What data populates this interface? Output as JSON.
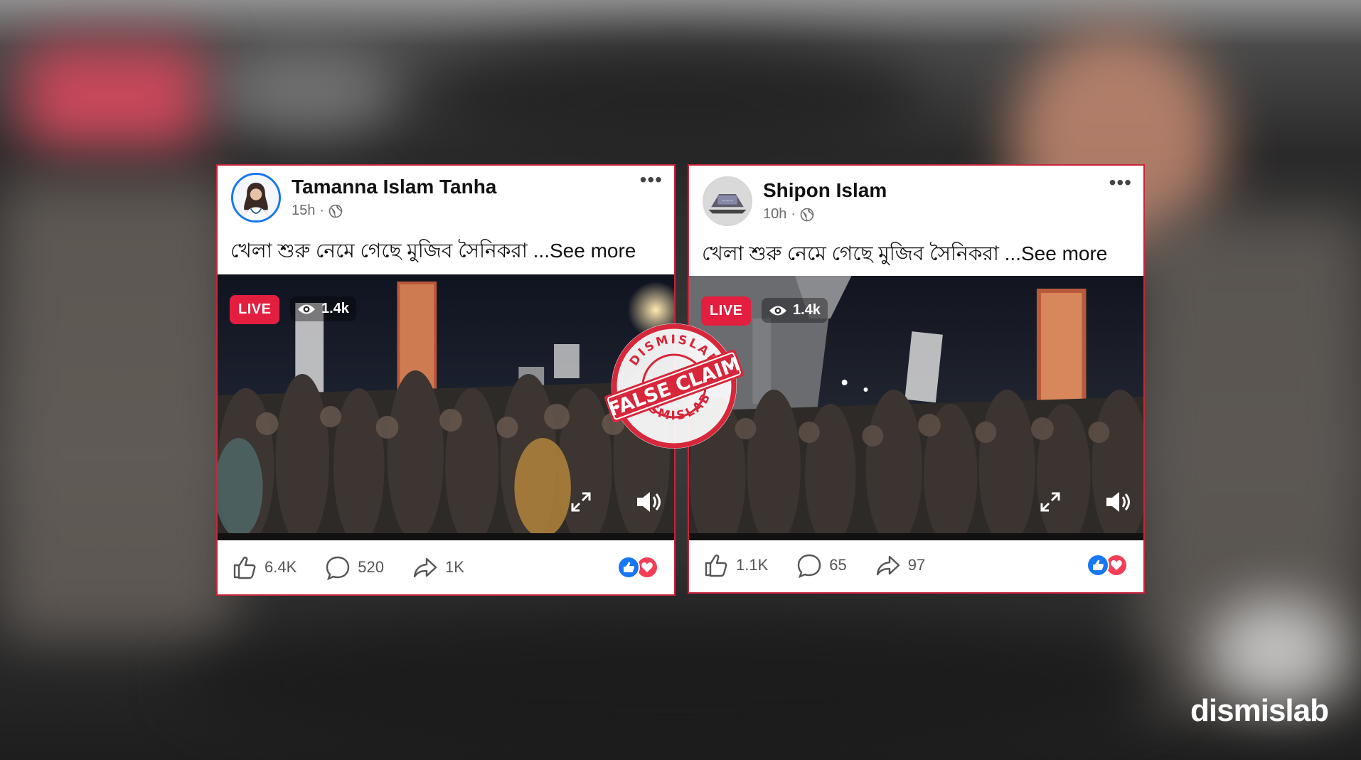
{
  "posts": [
    {
      "author": "Tamanna Islam Tanha",
      "time": "15h",
      "dot": "·",
      "more": "•••",
      "caption": "খেলা শুরু নেমে গেছে মুজিব সৈনিকরা ...See more",
      "live_label": "LIVE",
      "views": "1.4k",
      "likes": "6.4K",
      "comments": "520",
      "shares": "1K"
    },
    {
      "author": "Shipon Islam",
      "time": "10h",
      "dot": "·",
      "more": "•••",
      "caption": "খেলা শুরু নেমে গেছে মুজিব সৈনিকরা ...See more",
      "live_label": "LIVE",
      "views": "1.4k",
      "likes": "1.1K",
      "comments": "65",
      "shares": "97"
    }
  ],
  "stamp": {
    "label": "FALSE CLAIM",
    "ring_text": "DISMISLAB"
  },
  "brand": "dismislab",
  "colors": {
    "accent_border": "#c8253a",
    "live_red": "#e41e3f",
    "facebook_blue": "#1877f2",
    "love_red": "#f33e58",
    "stamp_red": "#d8263a"
  },
  "icons": [
    "globe-icon",
    "more-icon",
    "eye-icon",
    "expand-icon",
    "sound-icon",
    "like-icon",
    "comment-icon",
    "share-icon",
    "like-reaction-icon",
    "love-reaction-icon"
  ]
}
